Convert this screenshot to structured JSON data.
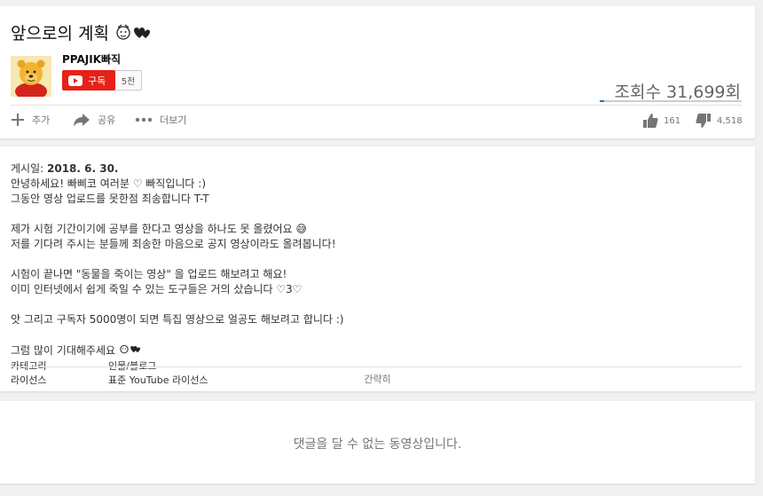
{
  "video": {
    "title": "앞으로의 계획",
    "view_count": "조회수 31,699회",
    "like_ratio": 0.034
  },
  "channel": {
    "name": "PPAJIK빠직",
    "subscribe_label": "구독",
    "subscriber_count": "5천"
  },
  "actions": {
    "add_label": "추가",
    "share_label": "공유",
    "more_label": "더보기",
    "like_count": "161",
    "dislike_count": "4,518"
  },
  "description": {
    "published_prefix": "게시일:",
    "published_date": "2018. 6. 30.",
    "lines": [
      "안녕하세요! 빠삐코 여러분 ♡ 빠직입니다 :)",
      "그동안 영상 업로드를 못한점 죄송합니다 T-T",
      "",
      "제가 시험 기간이기에 공부를 한다고 영상을 하나도 못 올렸어요 😅",
      "저를 기다려 주시는 분들께 죄송한 마음으로 공지 영상이라도 올려봅니다!",
      "",
      "시험이 끝나면 \"동물을 죽이는 영상\" 을 업로드 해보려고 해요!",
      "이미 인터넷에서 쉽게 죽일 수 있는 도구들은 거의 샀습니다 ♡3♡",
      "",
      "앗 그리고 구독자 5000명이 되면 특집 영상으로 얼공도 해보려고 합니다 :)",
      "",
      "그럼 많이 기대해주세요"
    ],
    "category_label": "카테고리",
    "category_value": "인물/블로그",
    "license_label": "라이선스",
    "license_value": "표준 YouTube 라이선스",
    "collapse_label": "간략히"
  },
  "comments": {
    "disabled_message": "댓글을 달 수 없는 동영상입니다."
  },
  "colors": {
    "brand_red": "#e62117",
    "like_blue": "#167ac6"
  },
  "icons": {
    "add": "plus-icon",
    "share": "share-arrow-icon",
    "more": "dots-icon",
    "like": "thumbs-up-icon",
    "dislike": "thumbs-down-icon",
    "subscribe": "youtube-play-icon"
  }
}
